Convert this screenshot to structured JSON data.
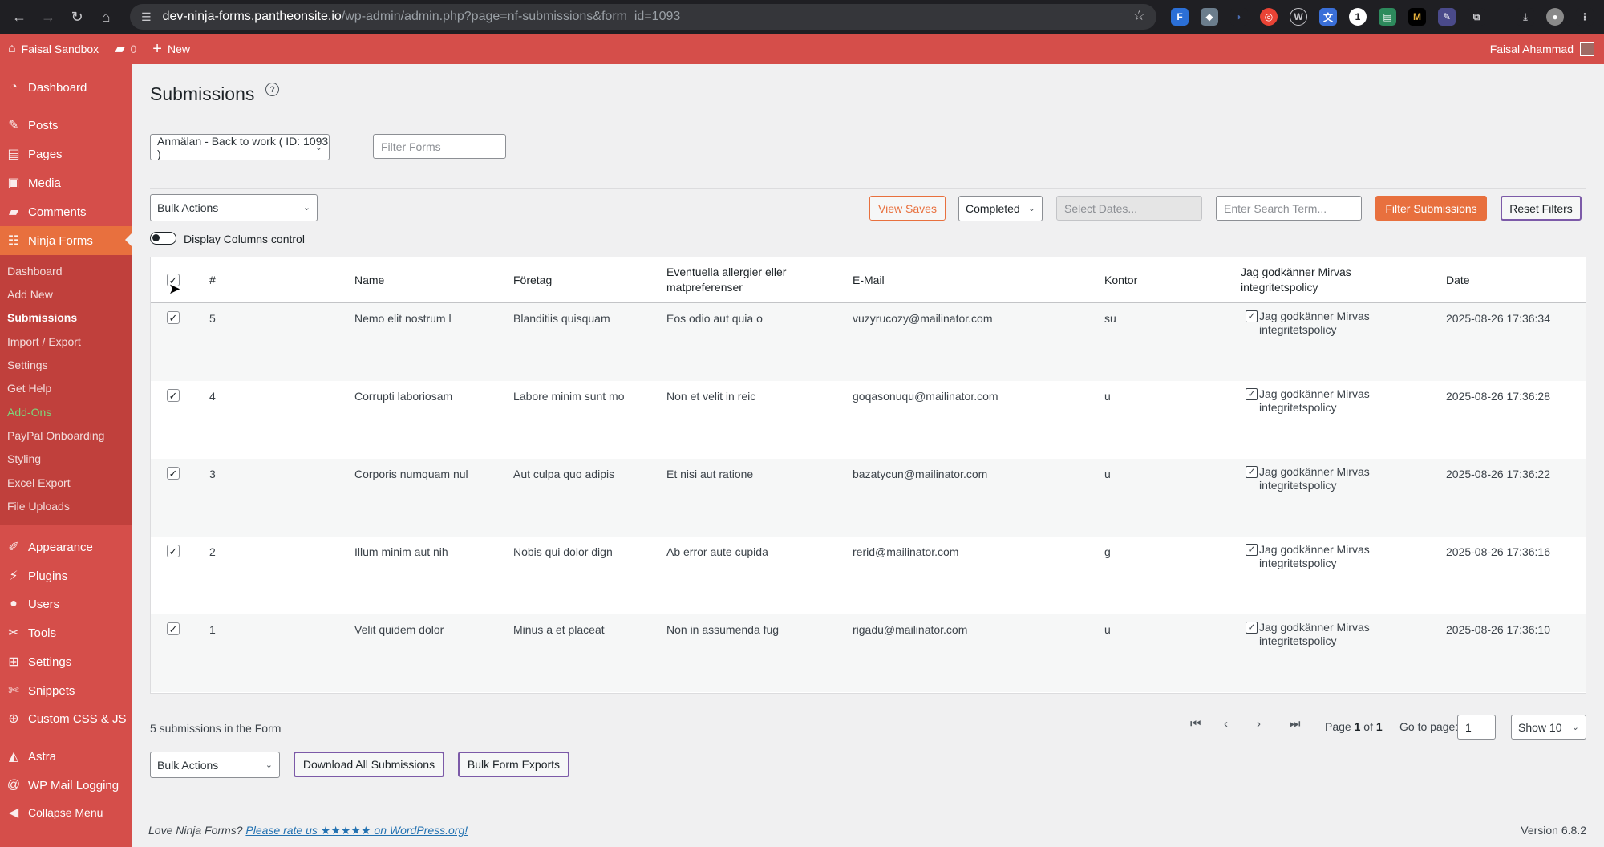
{
  "browser": {
    "url_host": "dev-ninja-forms.pantheonsite.io",
    "url_path": "/wp-admin/admin.php?page=nf-submissions&form_id=1093"
  },
  "adminbar": {
    "site": "Faisal Sandbox",
    "comments": "0",
    "new": "New",
    "user": "Faisal Ahammad"
  },
  "sidebar": {
    "items": [
      {
        "label": "Dashboard",
        "icon": "dashboard-icon"
      },
      {
        "label": "Posts",
        "icon": "pin-icon"
      },
      {
        "label": "Pages",
        "icon": "pages-icon"
      },
      {
        "label": "Media",
        "icon": "media-icon"
      },
      {
        "label": "Comments",
        "icon": "comment-icon"
      },
      {
        "label": "Ninja Forms",
        "icon": "forms-icon"
      },
      {
        "label": "Appearance",
        "icon": "brush-icon"
      },
      {
        "label": "Plugins",
        "icon": "plugin-icon"
      },
      {
        "label": "Users",
        "icon": "user-icon"
      },
      {
        "label": "Tools",
        "icon": "wrench-icon"
      },
      {
        "label": "Settings",
        "icon": "settings-icon"
      },
      {
        "label": "Snippets",
        "icon": "scissors-icon"
      },
      {
        "label": "Custom CSS & JS",
        "icon": "plus-circle-icon"
      },
      {
        "label": "Astra",
        "icon": "astra-icon"
      },
      {
        "label": "WP Mail Logging",
        "icon": "at-icon"
      },
      {
        "label": "Collapse Menu",
        "icon": "collapse-icon"
      }
    ],
    "submenu": [
      "Dashboard",
      "Add New",
      "Submissions",
      "Import / Export",
      "Settings",
      "Get Help",
      "Add-Ons",
      "PayPal Onboarding",
      "Styling",
      "Excel Export",
      "File Uploads"
    ]
  },
  "page": {
    "title": "Submissions",
    "form_select": "Anmälan - Back to work ( ID: 1093 )",
    "filter_forms_placeholder": "Filter Forms",
    "bulk_actions": "Bulk Actions",
    "view_saves": "View Saves",
    "status_select": "Completed",
    "dates_placeholder": "Select Dates...",
    "search_placeholder": "Enter Search Term...",
    "filter_button": "Filter Submissions",
    "reset_button": "Reset Filters",
    "columns_toggle": "Display Columns control"
  },
  "table": {
    "headers": [
      "#",
      "Name",
      "Företag",
      "Eventuella allergier eller matpreferenser",
      "E-Mail",
      "Kontor",
      "Jag godkänner Mirvas integritetspolicy",
      "Date"
    ],
    "rows": [
      {
        "id": "5",
        "name": "Nemo elit nostrum l",
        "company": "Blanditiis quisquam",
        "allergies": "Eos odio aut quia o",
        "email": "vuzyrucozy@mailinator.com",
        "office": "su",
        "policy": "Jag godkänner Mirvas integritetspolicy",
        "date": "2025-08-26 17:36:34"
      },
      {
        "id": "4",
        "name": "Corrupti laboriosam",
        "company": "Labore minim sunt mo",
        "allergies": "Non et velit in reic",
        "email": "goqasonuqu@mailinator.com",
        "office": "u",
        "policy": "Jag godkänner Mirvas integritetspolicy",
        "date": "2025-08-26 17:36:28"
      },
      {
        "id": "3",
        "name": "Corporis numquam nul",
        "company": "Aut culpa quo adipis",
        "allergies": "Et nisi aut ratione",
        "email": "bazatycun@mailinator.com",
        "office": "u",
        "policy": "Jag godkänner Mirvas integritetspolicy",
        "date": "2025-08-26 17:36:22"
      },
      {
        "id": "2",
        "name": "Illum minim aut nih",
        "company": "Nobis qui dolor dign",
        "allergies": "Ab error aute cupida",
        "email": "rerid@mailinator.com",
        "office": "g",
        "policy": "Jag godkänner Mirvas integritetspolicy",
        "date": "2025-08-26 17:36:16"
      },
      {
        "id": "1",
        "name": "Velit quidem dolor",
        "company": "Minus a et placeat",
        "allergies": "Non in assumenda fug",
        "email": "rigadu@mailinator.com",
        "office": "u",
        "policy": "Jag godkänner Mirvas integritetspolicy",
        "date": "2025-08-26 17:36:10"
      }
    ]
  },
  "footer": {
    "count": "5 submissions in the Form",
    "page_prefix": "Page ",
    "page_current": "1",
    "page_mid": " of ",
    "page_total": "1",
    "goto_label": "Go to page:",
    "goto_value": "1",
    "show_select": "Show 10",
    "bulk_actions": "Bulk Actions",
    "download_all": "Download All Submissions",
    "bulk_exports": "Bulk Form Exports",
    "love_prefix": "Love Ninja Forms?",
    "love_link": "Please rate us ★★★★★ on WordPress.org!",
    "version": "Version 6.8.2"
  },
  "colors": {
    "admin_red": "#d54e4a",
    "active_orange": "#e8703e",
    "reset_purple": "#7c5aa8"
  }
}
